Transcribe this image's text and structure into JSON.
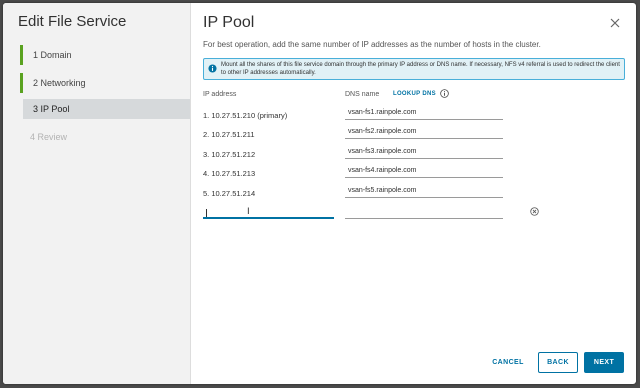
{
  "sidebar": {
    "title": "Edit File Service",
    "steps": [
      {
        "label": "1  Domain"
      },
      {
        "label": "2  Networking"
      },
      {
        "label": "3  IP Pool"
      },
      {
        "label": "4  Review"
      }
    ]
  },
  "main": {
    "title": "IP Pool",
    "hint": "For best operation, add the same number of IP addresses as the number of hosts in the cluster.",
    "info": "Mount all the shares of this file service domain through the primary IP address or DNS name. If necessary, NFS v4 referral is used to redirect the client to other IP addresses automatically.",
    "ip_header": "IP address",
    "dns_header": "DNS name",
    "lookup_label": "LOOKUP DNS",
    "rows": [
      {
        "ip": "1.  10.27.51.210 (primary)",
        "dns": "vsan-fs1.rainpole.com"
      },
      {
        "ip": "2.  10.27.51.211",
        "dns": "vsan-fs2.rainpole.com"
      },
      {
        "ip": "3.  10.27.51.212",
        "dns": "vsan-fs3.rainpole.com"
      },
      {
        "ip": "4.  10.27.51.213",
        "dns": "vsan-fs4.rainpole.com"
      },
      {
        "ip": "5.  10.27.51.214",
        "dns": "vsan-fs5.rainpole.com"
      }
    ],
    "new_ip_value": "",
    "new_dns_value": ""
  },
  "footer": {
    "cancel": "CANCEL",
    "back": "BACK",
    "next": "NEXT"
  },
  "colors": {
    "accent": "#0072a3",
    "done_step": "#5aa220",
    "info_bg": "#e1f1f6"
  },
  "icons": [
    "close-icon",
    "info-icon",
    "remove-icon",
    "text-cursor-icon"
  ]
}
